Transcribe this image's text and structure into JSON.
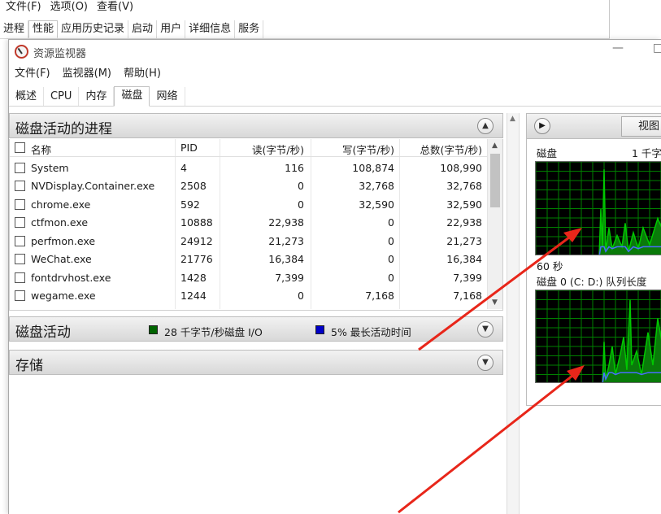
{
  "task_manager": {
    "menu": [
      "文件(F)",
      "选项(O)",
      "查看(V)"
    ],
    "tabs": [
      {
        "label": "进程",
        "active": false
      },
      {
        "label": "性能",
        "active": true
      },
      {
        "label": "应用历史记录",
        "active": false
      },
      {
        "label": "启动",
        "active": false
      },
      {
        "label": "用户",
        "active": false
      },
      {
        "label": "详细信息",
        "active": false
      },
      {
        "label": "服务",
        "active": false
      }
    ]
  },
  "resource_monitor": {
    "title": "资源监视器",
    "minimize_glyph": "—",
    "maximize_glyph": "□",
    "menu": [
      "文件(F)",
      "监视器(M)",
      "帮助(H)"
    ],
    "tabs": [
      {
        "label": "概述",
        "active": false
      },
      {
        "label": "CPU",
        "active": false
      },
      {
        "label": "内存",
        "active": false
      },
      {
        "label": "磁盘",
        "active": true
      },
      {
        "label": "网络",
        "active": false
      }
    ],
    "processes_section": {
      "title": "磁盘活动的进程",
      "columns": [
        "名称",
        "PID",
        "读(字节/秒)",
        "写(字节/秒)",
        "总数(字节/秒)"
      ],
      "rows": [
        {
          "name": "System",
          "pid": "4",
          "read": "116",
          "write": "108,874",
          "total": "108,990"
        },
        {
          "name": "NVDisplay.Container.exe",
          "pid": "2508",
          "read": "0",
          "write": "32,768",
          "total": "32,768"
        },
        {
          "name": "chrome.exe",
          "pid": "592",
          "read": "0",
          "write": "32,590",
          "total": "32,590"
        },
        {
          "name": "ctfmon.exe",
          "pid": "10888",
          "read": "22,938",
          "write": "0",
          "total": "22,938"
        },
        {
          "name": "perfmon.exe",
          "pid": "24912",
          "read": "21,273",
          "write": "0",
          "total": "21,273"
        },
        {
          "name": "WeChat.exe",
          "pid": "21776",
          "read": "16,384",
          "write": "0",
          "total": "16,384"
        },
        {
          "name": "fontdrvhost.exe",
          "pid": "1428",
          "read": "7,399",
          "write": "0",
          "total": "7,399"
        },
        {
          "name": "wegame.exe",
          "pid": "1244",
          "read": "0",
          "write": "7,168",
          "total": "7,168"
        }
      ]
    },
    "disk_activity_section": {
      "title": "磁盘活动",
      "legend_io": "28 千字节/秒磁盘 I/O",
      "legend_io_color": "#006400",
      "legend_active": "5% 最长活动时间",
      "legend_active_color": "#0000c8"
    },
    "storage_section": {
      "title": "存储"
    },
    "graph_panel": {
      "view_label": "视图",
      "graph1_title": "磁盘",
      "graph1_scale": "1 千字",
      "graph1_time": "60 秒",
      "graph2_title": "磁盘 0 (C: D:) 队列长度",
      "line_color": "#00c800",
      "fill_color": "#0a7a0a",
      "secondary_color": "#4a6cff",
      "grid_color": "#008000"
    }
  }
}
